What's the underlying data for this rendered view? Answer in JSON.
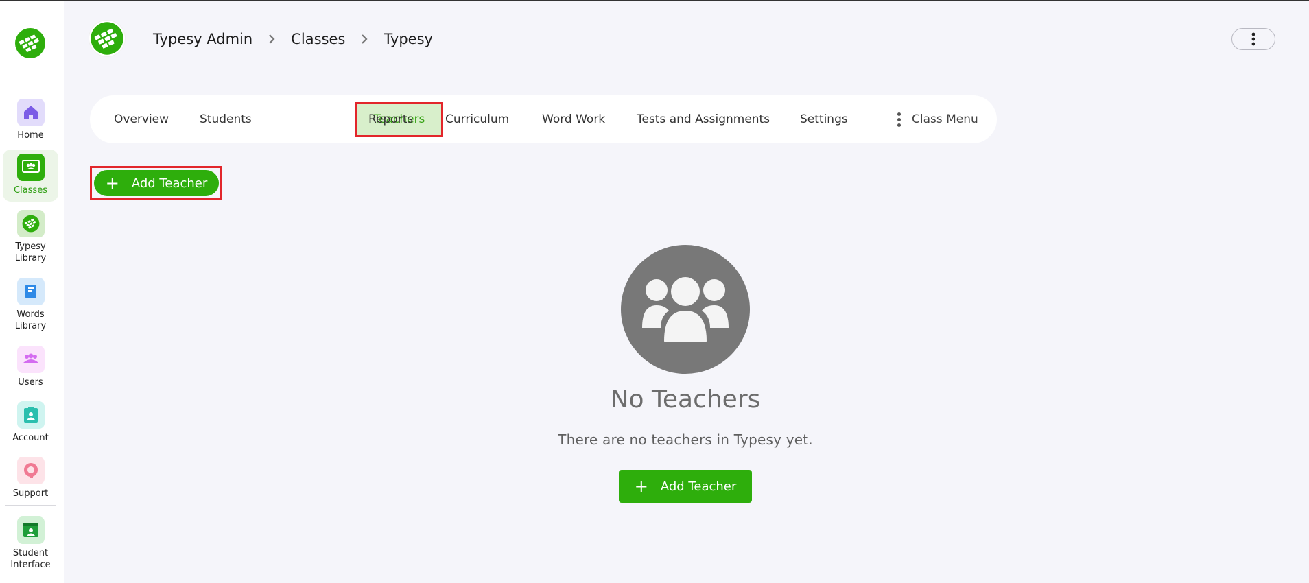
{
  "sidebar": {
    "items": [
      {
        "label": "Home",
        "icon": "home-icon",
        "color": "#ddd6fa",
        "active": false
      },
      {
        "label": "Classes",
        "icon": "classes-icon",
        "color": "#2eae0c",
        "active": true
      },
      {
        "label": "Typesy Library",
        "icon": "typesy-library-icon",
        "color": "#cfe9c4",
        "active": false
      },
      {
        "label": "Words Library",
        "icon": "words-library-icon",
        "color": "#d3e8fb",
        "active": false
      },
      {
        "label": "Users",
        "icon": "users-icon",
        "color": "#fae1fb",
        "active": false
      },
      {
        "label": "Account",
        "icon": "account-icon",
        "color": "#cdf3ef",
        "active": false
      },
      {
        "label": "Support",
        "icon": "support-icon",
        "color": "#fde1e6",
        "active": false
      },
      {
        "label": "Student Interface",
        "icon": "student-interface-icon",
        "color": "#cfefd3",
        "active": false
      }
    ]
  },
  "header": {
    "breadcrumb": [
      "Typesy Admin",
      "Classes",
      "Typesy"
    ]
  },
  "tabs": [
    {
      "label": "Overview",
      "active": false
    },
    {
      "label": "Students",
      "active": false
    },
    {
      "label": "Teachers",
      "active": true
    },
    {
      "label": "Reports",
      "active": false
    },
    {
      "label": "Curriculum",
      "active": false
    },
    {
      "label": "Word Work",
      "active": false
    },
    {
      "label": "Tests and Assignments",
      "active": false
    },
    {
      "label": "Settings",
      "active": false
    }
  ],
  "class_menu_label": "Class Menu",
  "actions": {
    "add_teacher_top": "Add Teacher",
    "add_teacher_center": "Add Teacher",
    "plus": "+"
  },
  "empty_state": {
    "icon": "group-icon",
    "title": "No Teachers",
    "text": "There are no teachers in Typesy yet."
  },
  "colors": {
    "accent": "#2eae0c",
    "highlight_frame": "#e2262b",
    "active_tab_bg": "#d8efcb"
  }
}
